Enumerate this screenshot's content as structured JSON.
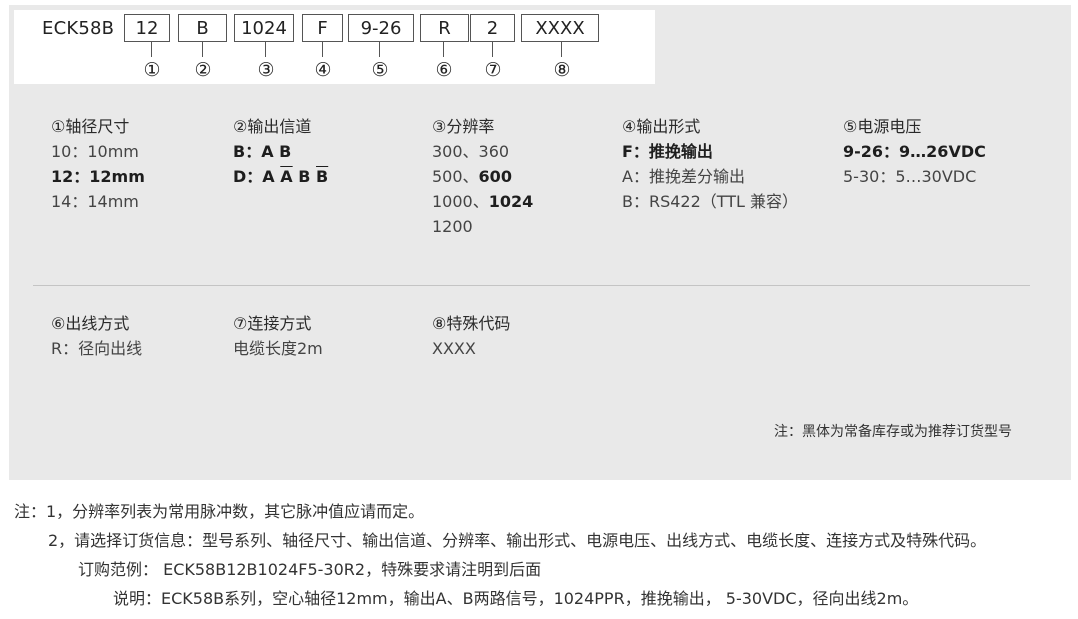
{
  "model": {
    "prefix": "ECK58B",
    "segments": [
      "12",
      "B",
      "1024",
      "F",
      "9-26",
      "R",
      "2",
      "XXXX"
    ],
    "markers": [
      "①",
      "②",
      "③",
      "④",
      "⑤",
      "⑥",
      "⑦",
      "⑧"
    ]
  },
  "options": {
    "shaft": {
      "title": "①轴径尺寸",
      "items": [
        "10：10mm",
        "12：12mm",
        "14：14mm"
      ]
    },
    "channel": {
      "title": "②输出信道",
      "b_label": "B：",
      "b_value": "A B",
      "d_label": "D：",
      "d_a": "A",
      "d_abar": "A",
      "d_b": "B",
      "d_bbar": "B"
    },
    "resolution": {
      "title": "③分辨率",
      "line1": "300、360",
      "line2_a": "500、",
      "line2_b": "600",
      "line3_a": "1000、",
      "line3_b": "1024",
      "line4": "1200"
    },
    "output": {
      "title": "④输出形式",
      "items": [
        "F：推挽输出",
        "A：推挽差分输出",
        "B：RS422（TTL 兼容）"
      ]
    },
    "voltage": {
      "title": "⑤电源电压",
      "items": [
        "9-26：9…26VDC",
        "5-30：5…30VDC"
      ]
    },
    "cable_dir": {
      "title": "⑥出线方式",
      "items": [
        "R：径向出线"
      ]
    },
    "connection": {
      "title": "⑦连接方式",
      "items": [
        "电缆长度2m"
      ]
    },
    "special": {
      "title": "⑧特殊代码",
      "items": [
        "XXXX"
      ]
    }
  },
  "panel_note": "注：黑体为常备库存或为推荐订货型号",
  "notes": {
    "line1": "注：1，分辨率列表为常用脉冲数，其它脉冲值应请而定。",
    "line2": "2，请选择订货信息：型号系列、轴径尺寸、输出信道、分辨率、输出形式、电源电压、出线方式、电缆长度、连接方式及特殊代码。",
    "line3": "订购范例： ECK58B12B1024F5-30R2，特殊要求请注明到后面",
    "line4": "说明：ECK58B系列，空心轴径12mm，输出A、B两路信号，1024PPR，推挽输出， 5-30VDC，径向出线2m。"
  }
}
